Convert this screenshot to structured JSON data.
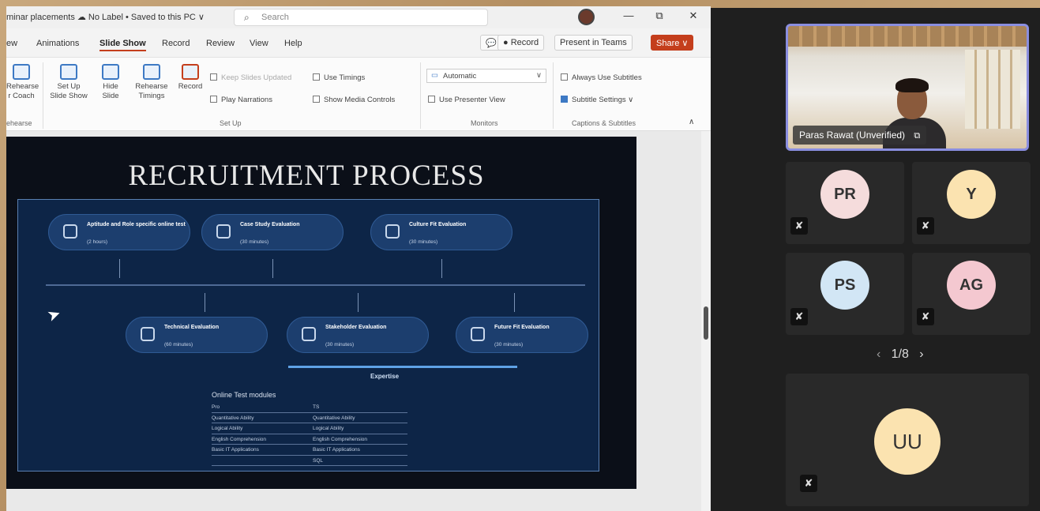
{
  "powerpoint": {
    "doc_title": "minar placements  ☁ No Label • Saved to this PC ∨",
    "search_placeholder": "Search",
    "window_controls": {
      "minimize": "—",
      "restore": "⧉",
      "close": "✕"
    },
    "tabs": [
      "ew",
      "Animations",
      "Slide Show",
      "Record",
      "Review",
      "View",
      "Help"
    ],
    "active_tab": "Slide Show",
    "right_buttons": {
      "comment": "💬",
      "record": "● Record",
      "present_teams": "Present in Teams",
      "share": "Share ∨"
    },
    "ribbon": {
      "rehearse": "Rehearse\nr Coach",
      "setup_slideshow": "Set Up\nSlide Show",
      "hide_slide": "Hide\nSlide",
      "rehearse_timings": "Rehearse\nTimings",
      "record": "Record",
      "keep_slides_updated": "Keep Slides Updated",
      "play_narrations": "Play Narrations",
      "use_timings": "Use Timings",
      "show_media_controls": "Show Media Controls",
      "monitor_value": "Automatic",
      "use_presenter_view": "Use Presenter View",
      "always_use_subtitles": "Always Use Subtitles",
      "subtitle_settings": "Subtitle Settings ∨",
      "group_rehearse": "ehearse",
      "group_setup": "Set Up",
      "group_monitors": "Monitors",
      "group_captions": "Captions & Subtitles",
      "collapse": "∧"
    }
  },
  "slide": {
    "title": "RECRUITMENT PROCESS",
    "top_stages": [
      {
        "title": "Aptitude and Role specific online test",
        "duration": "(2 hours)"
      },
      {
        "title": "Case Study Evaluation",
        "duration": "(30 minutes)"
      },
      {
        "title": "Culture Fit Evaluation",
        "duration": "(30 minutes)"
      }
    ],
    "bottom_stages": [
      {
        "title": "Technical Evaluation",
        "duration": "(60 minutes)"
      },
      {
        "title": "Stakeholder Evaluation",
        "duration": "(30 minutes)"
      },
      {
        "title": "Future Fit Evaluation",
        "duration": "(30 minutes)"
      }
    ],
    "expertise_label": "Expertise",
    "online_test": {
      "title": "Online Test modules",
      "rows": [
        [
          "Pro",
          "TS"
        ],
        [
          "Quantitative Ability",
          "Quantitative Ability"
        ],
        [
          "Logical Ability",
          "Logical Ability"
        ],
        [
          "English Comprehension",
          "English Comprehension"
        ],
        [
          "Basic IT Applications",
          "Basic IT Applications"
        ],
        [
          "",
          "SQL"
        ]
      ]
    }
  },
  "teams": {
    "speaker_name": "Paras Rawat (Unverified)",
    "participants": [
      {
        "initials": "PR",
        "color": "#f5dcdc"
      },
      {
        "initials": "Y",
        "color": "#fbe3b0"
      },
      {
        "initials": "PS",
        "color": "#d2e6f5"
      },
      {
        "initials": "AG",
        "color": "#f4c8d0"
      }
    ],
    "pager": "1/8",
    "pager_prev": "‹",
    "pager_next": "›",
    "big_participant": {
      "initials": "UU",
      "color": "#fbe3b0"
    },
    "muted_icon": "mic-off-icon"
  }
}
